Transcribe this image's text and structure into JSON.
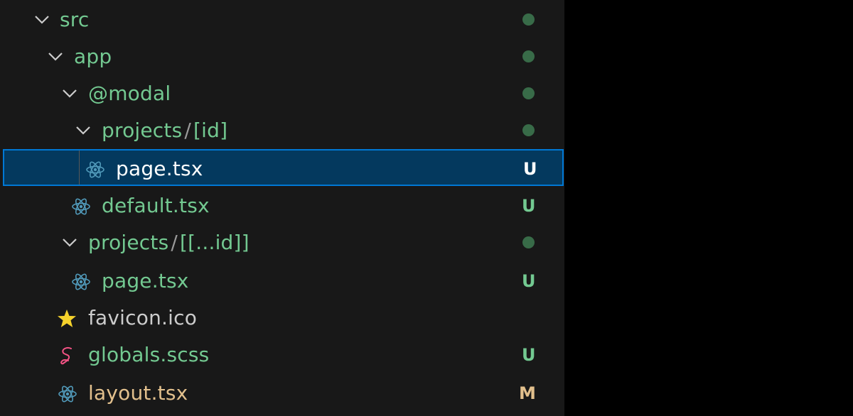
{
  "explorer": {
    "rows": [
      {
        "label": "src",
        "kind": "folder",
        "expanded": true,
        "decoration": "dot"
      },
      {
        "label": "app",
        "kind": "folder",
        "expanded": true,
        "decoration": "dot"
      },
      {
        "label": "@modal",
        "kind": "folder",
        "expanded": true,
        "decoration": "dot"
      },
      {
        "label_parts": [
          "projects",
          "/",
          "[id]"
        ],
        "kind": "folder",
        "expanded": true,
        "decoration": "dot"
      },
      {
        "label": "page.tsx",
        "kind": "file",
        "icon": "react-icon",
        "status": "U",
        "selected": true
      },
      {
        "label": "default.tsx",
        "kind": "file",
        "icon": "react-icon",
        "status": "U"
      },
      {
        "label_parts": [
          "projects",
          "/",
          "[[...id]]"
        ],
        "kind": "folder",
        "expanded": true,
        "decoration": "dot"
      },
      {
        "label": "page.tsx",
        "kind": "file",
        "icon": "react-icon",
        "status": "U"
      },
      {
        "label": "favicon.ico",
        "kind": "file",
        "icon": "star-icon",
        "status": ""
      },
      {
        "label": "globals.scss",
        "kind": "file",
        "icon": "sass-icon",
        "status": "U"
      },
      {
        "label": "layout.tsx",
        "kind": "file",
        "icon": "react-icon",
        "status": "M"
      }
    ]
  },
  "colors": {
    "background": "#181818",
    "untracked": "#73c991",
    "modified": "#e2c08d",
    "selection": "#04395e",
    "selection_border": "#0078d4",
    "react_icon": "#519aba",
    "sass_icon": "#f55385",
    "star_icon": "#f5d22c"
  }
}
